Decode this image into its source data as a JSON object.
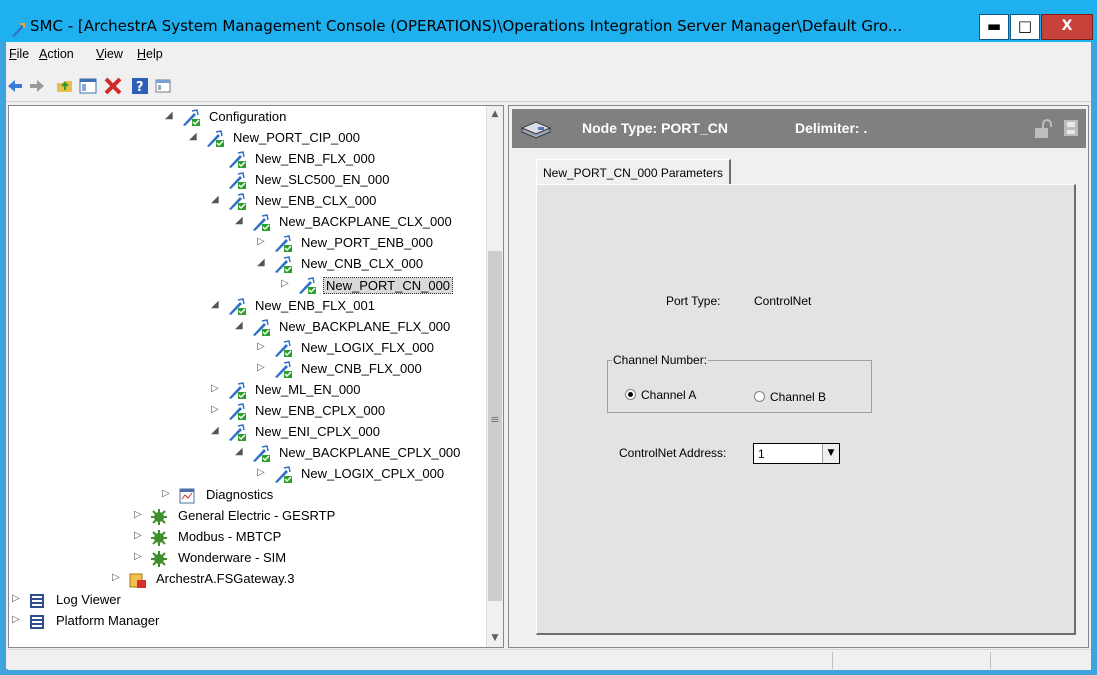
{
  "window": {
    "title": "SMC - [ArchestrA System Management Console (OPERATIONS)\\Operations Integration Server Manager\\Default Gro...",
    "min_glyph": "▬",
    "max_glyph": "□",
    "close_glyph": "X"
  },
  "menu": [
    {
      "underline": "F",
      "rest": "ile"
    },
    {
      "underline": "A",
      "rest": "ction"
    },
    {
      "underline": "V",
      "rest": "iew"
    },
    {
      "underline": "H",
      "rest": "elp"
    }
  ],
  "toolbar_icons": [
    "back-arrow-icon",
    "forward-arrow-icon",
    "up-folder-icon",
    "show-hide-tree-icon",
    "delete-icon",
    "help-icon",
    "properties-icon"
  ],
  "tree": {
    "items": [
      {
        "label": "Configuration",
        "icon": "plug-icon",
        "expander": "◢"
      },
      {
        "label": "New_PORT_CIP_000",
        "icon": "plug-icon",
        "expander": "◢"
      },
      {
        "label": "New_ENB_FLX_000",
        "icon": "plug-icon",
        "expander": ""
      },
      {
        "label": "New_SLC500_EN_000",
        "icon": "plug-icon",
        "expander": ""
      },
      {
        "label": "New_ENB_CLX_000",
        "icon": "plug-icon",
        "expander": "◢"
      },
      {
        "label": "New_BACKPLANE_CLX_000",
        "icon": "plug-icon",
        "expander": "◢"
      },
      {
        "label": "New_PORT_ENB_000",
        "icon": "plug-icon",
        "expander": "▷"
      },
      {
        "label": "New_CNB_CLX_000",
        "icon": "plug-icon",
        "expander": "◢"
      },
      {
        "label": "New_PORT_CN_000",
        "icon": "plug-icon",
        "expander": "▷"
      },
      {
        "label": "New_ENB_FLX_001",
        "icon": "plug-icon",
        "expander": "◢"
      },
      {
        "label": "New_BACKPLANE_FLX_000",
        "icon": "plug-icon",
        "expander": "◢"
      },
      {
        "label": "New_LOGIX_FLX_000",
        "icon": "plug-icon",
        "expander": "▷"
      },
      {
        "label": "New_CNB_FLX_000",
        "icon": "plug-icon",
        "expander": "▷"
      },
      {
        "label": "New_ML_EN_000",
        "icon": "plug-icon",
        "expander": "▷"
      },
      {
        "label": "New_ENB_CPLX_000",
        "icon": "plug-icon",
        "expander": "▷"
      },
      {
        "label": "New_ENI_CPLX_000",
        "icon": "plug-icon",
        "expander": "◢"
      },
      {
        "label": "New_BACKPLANE_CPLX_000",
        "icon": "plug-icon",
        "expander": "◢"
      },
      {
        "label": "New_LOGIX_CPLX_000",
        "icon": "plug-icon",
        "expander": "▷"
      },
      {
        "label": "Diagnostics",
        "icon": "diagnostics-icon",
        "expander": "▷"
      },
      {
        "label": "General Electric - GESRTP",
        "icon": "gear-icon",
        "expander": "▷"
      },
      {
        "label": "Modbus - MBTCP",
        "icon": "gear-icon",
        "expander": "▷"
      },
      {
        "label": "Wonderware - SIM",
        "icon": "gear-icon",
        "expander": "▷"
      },
      {
        "label": "ArchestrA.FSGateway.3",
        "icon": "gateway-icon",
        "expander": "▷"
      },
      {
        "label": "Log Viewer",
        "icon": "log-viewer-icon",
        "expander": "▷"
      },
      {
        "label": "Platform Manager",
        "icon": "platform-manager-icon",
        "expander": "▷"
      }
    ],
    "selected": "New_PORT_CN_000"
  },
  "node": {
    "type_label": "Node Type: PORT_CN",
    "delimiter_label": "Delimiter: ."
  },
  "params": {
    "tab_label": "New_PORT_CN_000 Parameters",
    "port_type_label": "Port Type:",
    "port_type_value": "ControlNet",
    "channel_group_title": "Channel Number:",
    "channel_a": "Channel A",
    "channel_b": "Channel B",
    "selected_channel": "Channel A",
    "address_label": "ControlNet Address:",
    "address_value": "1"
  },
  "colors": {
    "title_bar": "#1fb0f0",
    "close_button": "#c7423b",
    "node_header": "#808080"
  }
}
